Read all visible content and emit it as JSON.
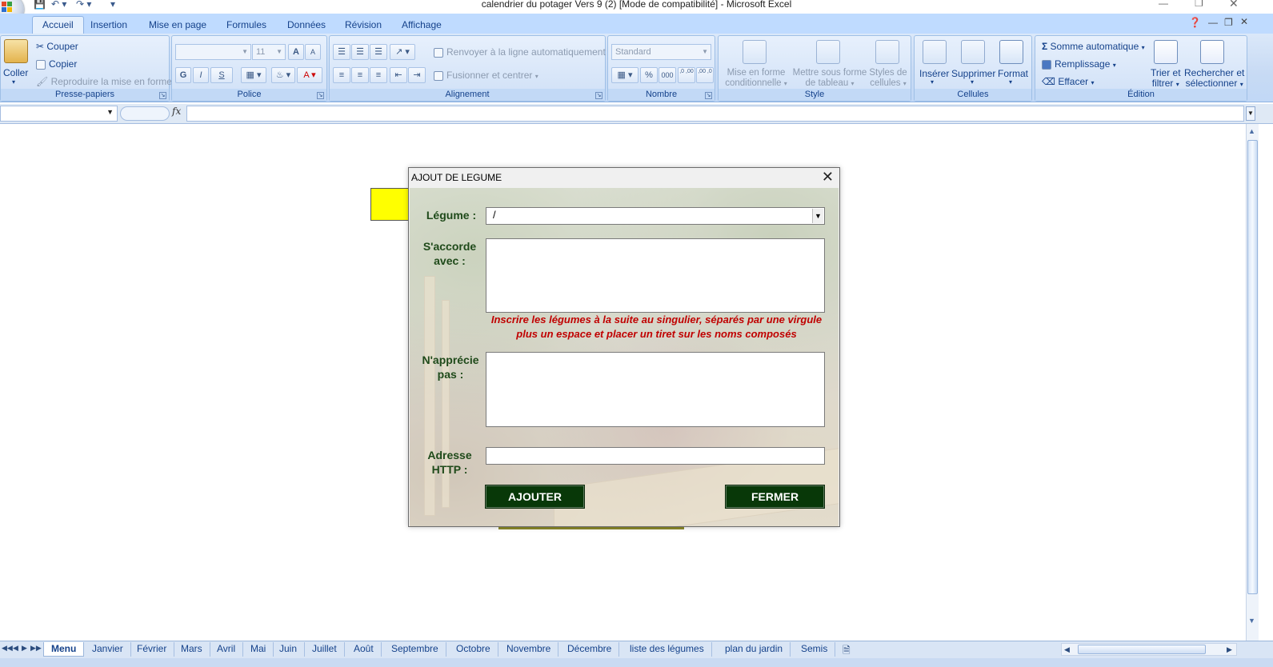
{
  "window": {
    "title": "calendrier du potager Vers 9 (2)  [Mode de compatibilité] - Microsoft Excel"
  },
  "ribbon_tabs": [
    "Accueil",
    "Insertion",
    "Mise en page",
    "Formules",
    "Données",
    "Révision",
    "Affichage"
  ],
  "clipboard": {
    "paste": "Coller",
    "cut": "Couper",
    "copy": "Copier",
    "format_painter": "Reproduire la mise en forme",
    "group": "Presse-papiers"
  },
  "font": {
    "size": "11",
    "bold": "G",
    "italic": "I",
    "underline": "S",
    "group": "Police"
  },
  "alignment": {
    "wrap": "Renvoyer à la ligne automatiquement",
    "merge": "Fusionner et centrer",
    "group": "Alignement"
  },
  "number": {
    "format": "Standard",
    "percent": "%",
    "thousands": "000",
    "inc_decimal": ",0 ,00",
    "dec_decimal": ",00 ,0",
    "group": "Nombre"
  },
  "style": {
    "conditional": [
      "Mise en forme",
      "conditionnelle"
    ],
    "table": [
      "Mettre sous forme",
      "de tableau"
    ],
    "cell_styles": [
      "Styles de",
      "cellules"
    ],
    "group": "Style"
  },
  "cells": {
    "insert": "Insérer",
    "delete": "Supprimer",
    "format": "Format",
    "group": "Cellules"
  },
  "editing": {
    "autosum": "Somme automatique",
    "fill": "Remplissage",
    "clear": "Effacer",
    "sort": [
      "Trier et",
      "filtrer"
    ],
    "find": [
      "Rechercher et",
      "sélectionner"
    ],
    "group": "Édition"
  },
  "formula_bar": {
    "fx": "fx"
  },
  "dialog": {
    "title": "AJOUT DE LEGUME",
    "legume_label": "Légume :",
    "legume_value": "/",
    "saccorde_label": [
      "S'accorde",
      "avec :"
    ],
    "hint": [
      "Inscrire les légumes à la suite au singulier, séparés par une virgule",
      "plus un espace et placer un tiret sur les noms composés"
    ],
    "napprecie_label": [
      "N'apprécie",
      "pas :"
    ],
    "adresse_label": [
      "Adresse",
      "HTTP :"
    ],
    "add_button": "AJOUTER",
    "close_button": "FERMER"
  },
  "sheet_tabs": [
    "Menu",
    "Janvier",
    "Février",
    "Mars",
    "Avril",
    "Mai",
    "Juin",
    "Juillet",
    "Août",
    "Septembre",
    "Octobre",
    "Novembre",
    "Décembre",
    "liste des légumes",
    "plan du jardin",
    "Semis"
  ],
  "colors": {
    "ribbon_bg": "#c7daf4",
    "dialog_button": "#083808",
    "hint_text": "#c00000",
    "label_text": "#1f4a1a",
    "highlight_cell": "#ffff00"
  }
}
